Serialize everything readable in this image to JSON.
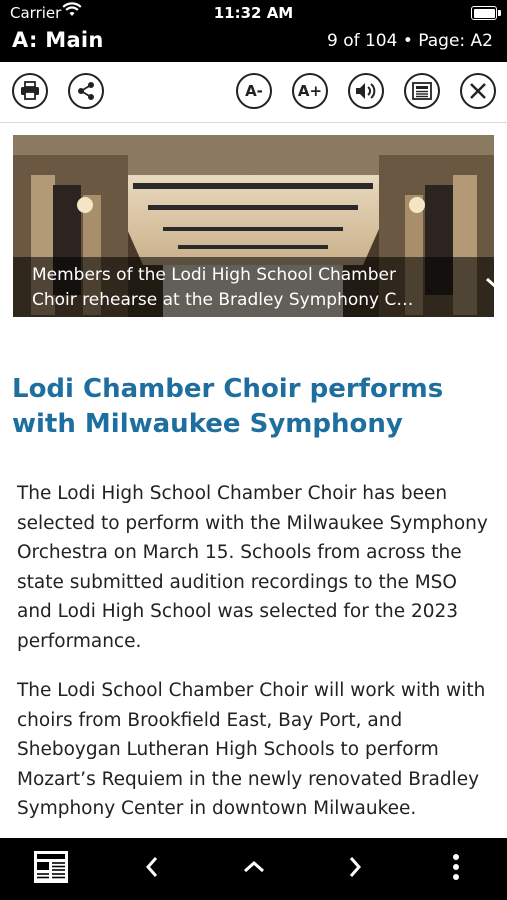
{
  "status_bar": {
    "carrier": "Carrier",
    "time": "11:32 AM"
  },
  "header": {
    "section": "A: Main",
    "page_info": "9 of 104 • Page: A2"
  },
  "toolbar": {
    "print_icon": "printer-icon",
    "share_icon": "share-icon",
    "font_decrease_label": "A-",
    "font_increase_label": "A+",
    "audio_icon": "speaker-icon",
    "page_view_icon": "newspaper-icon",
    "close_icon": "close-icon"
  },
  "article": {
    "photo_caption_line1": "Members of the Lodi High School Chamber",
    "photo_caption_line2": "Choir rehearse at the Bradley Symphony C…",
    "headline": "Lodi Chamber Choir performs with Milwaukee Symphony",
    "paragraphs": [
      "The Lodi High School Chamber Choir has been selected to perform with the Milwaukee Symphony Orchestra on March 15. Schools from across the state submitted audition recordings to the MSO and Lodi High School was selected for the 2023 performance.",
      "The Lodi School Chamber Choir will work with with choirs from Brookfield East, Bay Port, and Sheboygan Lutheran High Schools to perform Mozart’s Requiem in the newly renovated Bradley Symphony Center in downtown Milwaukee."
    ]
  },
  "bottom_bar": {
    "icons": [
      "page-thumbnail-icon",
      "chevron-left-icon",
      "chevron-up-icon",
      "chevron-right-icon",
      "more-vertical-icon"
    ]
  },
  "colors": {
    "headline": "#1e6f9f",
    "bars": "#000000"
  }
}
